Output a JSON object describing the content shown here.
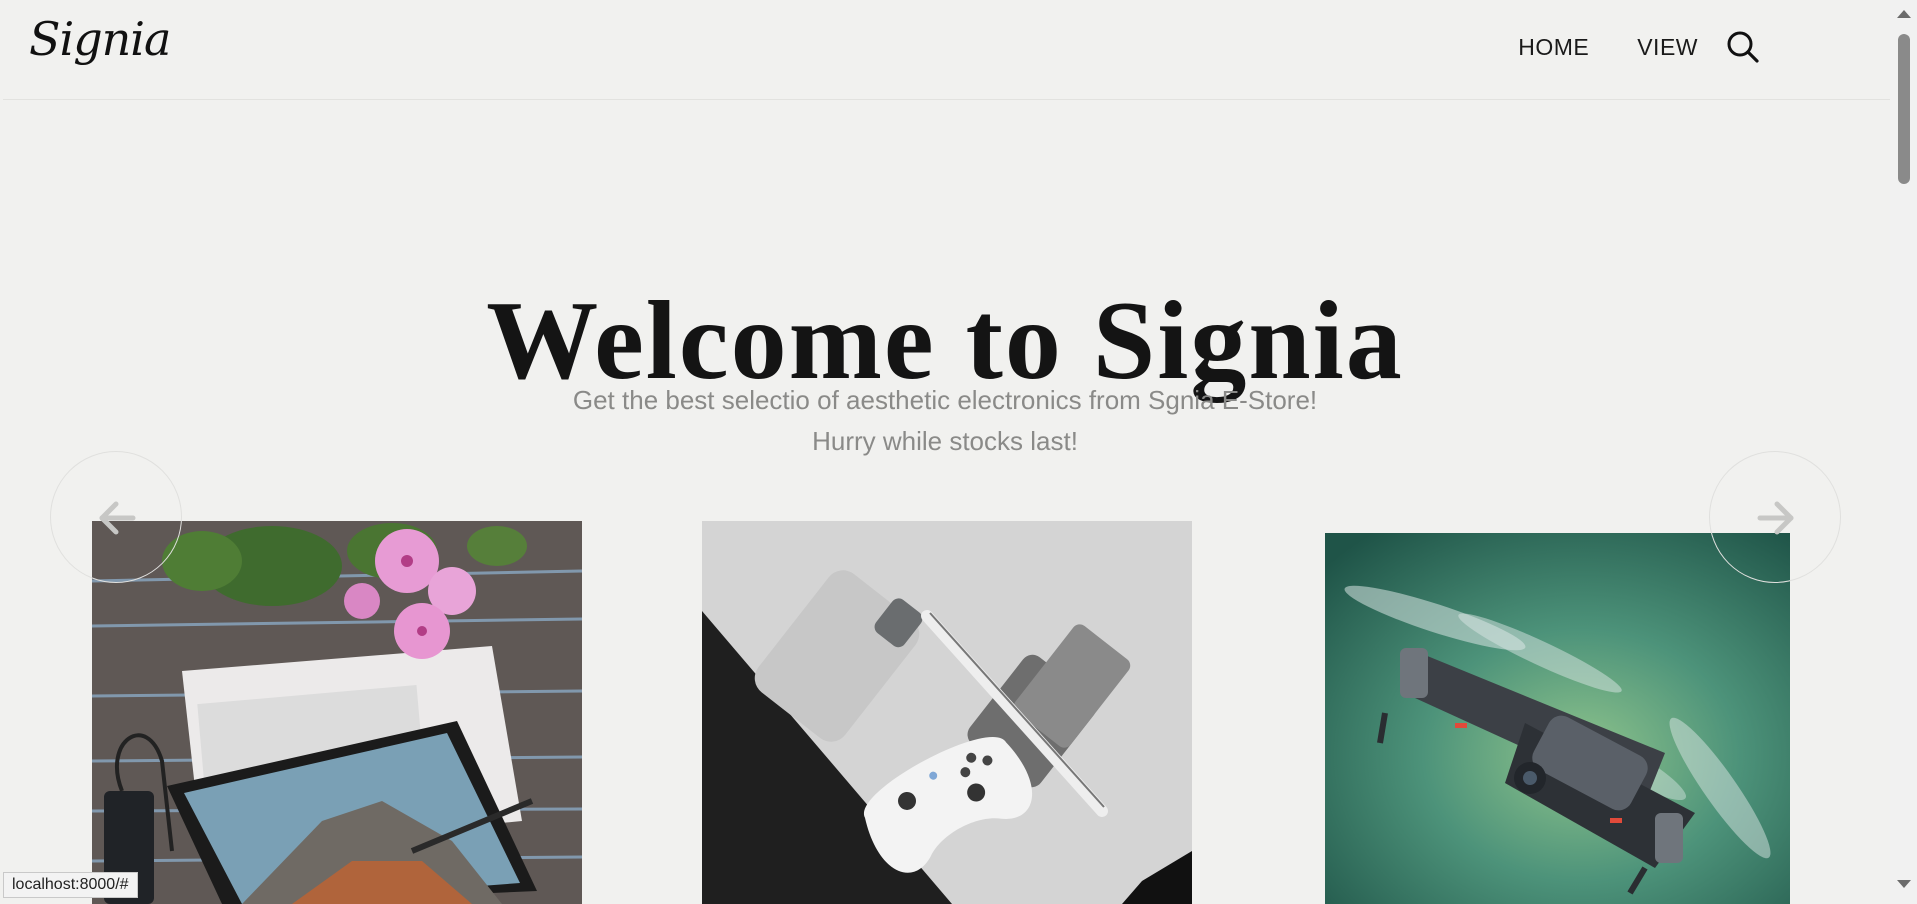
{
  "header": {
    "logo_text": "Signia",
    "nav": [
      {
        "label": "HOME"
      },
      {
        "label": "VIEW"
      }
    ],
    "search_icon": "search-icon"
  },
  "hero": {
    "title": "Welcome to Signia",
    "subtitle_line1": "Get the best selectio of aesthetic electronics from Sgnia E-Store!",
    "subtitle_line2": "Hurry while stocks last!"
  },
  "carousel": {
    "prev_icon": "arrow-left-icon",
    "next_icon": "arrow-right-icon",
    "items": [
      {
        "image": "laptop-tablet-flowers-photo"
      },
      {
        "image": "phone-controller-stand-photo"
      },
      {
        "image": "drone-photo"
      }
    ]
  },
  "status_bar": {
    "url": "localhost:8000/#"
  },
  "colors": {
    "background": "#f1f1ef",
    "text": "#141414",
    "muted_text": "#8a8a88"
  }
}
